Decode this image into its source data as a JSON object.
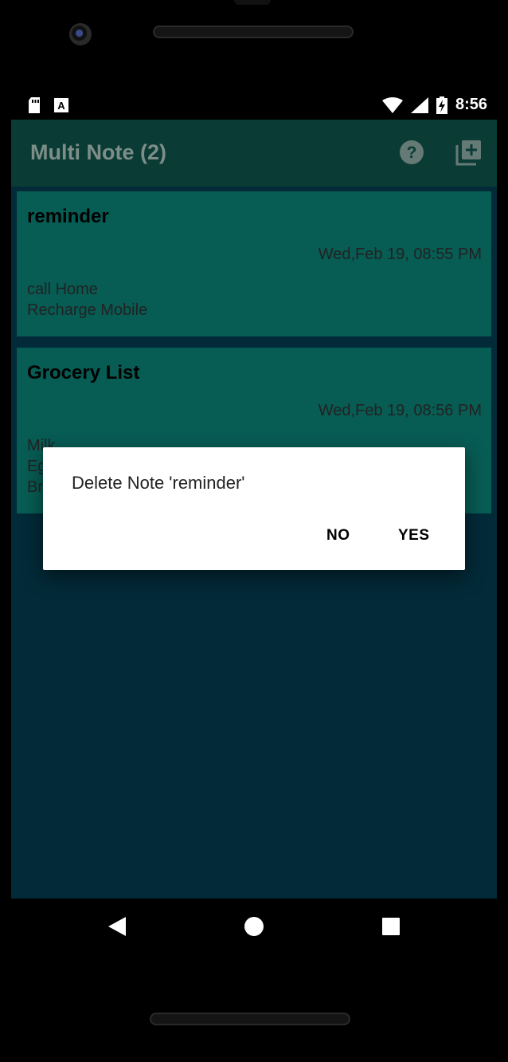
{
  "status_bar": {
    "time": "8:56",
    "left_icons": [
      "sd-card-icon",
      "notification-a-icon"
    ],
    "right_icons": [
      "wifi-icon",
      "cell-signal-icon",
      "battery-charging-icon"
    ]
  },
  "app_bar": {
    "title": "Multi Note (2)",
    "actions": [
      "help-icon",
      "add-note-icon"
    ]
  },
  "notes": [
    {
      "title": "reminder",
      "date": "Wed,Feb 19, 08:55 PM",
      "body": "call Home\nRecharge Mobile"
    },
    {
      "title": "Grocery List",
      "date": "Wed,Feb 19, 08:56 PM",
      "body": "Milk\nEggs\nBread"
    }
  ],
  "dialog": {
    "message": "Delete Note 'reminder'",
    "negative": "NO",
    "positive": "YES"
  },
  "colors": {
    "app_bar": "#0a3b35",
    "background": "#032a38",
    "card": "#075c54",
    "dialog": "#ffffff"
  }
}
